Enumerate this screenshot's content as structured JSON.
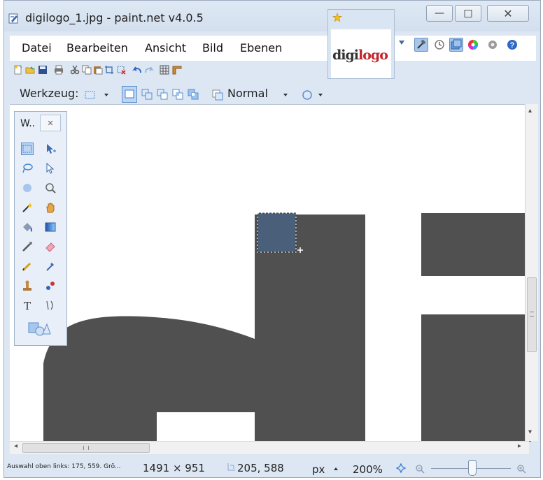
{
  "window": {
    "title": "digilogo_1.jpg - paint.net v4.0.5",
    "minimize_symbol": "—",
    "maximize_symbol": "□",
    "close_symbol": "✕"
  },
  "menu": {
    "items": [
      "Datei",
      "Bearbeiten",
      "Ansicht",
      "Bild",
      "Ebenen"
    ]
  },
  "image_thumbnail": {
    "logo_part1": "digi",
    "logo_part2": "logo"
  },
  "toolbar": {
    "tool_label": "Werkzeug:",
    "blend_mode": "Normal"
  },
  "tools_window": {
    "title": "W..",
    "close_symbol": "✕",
    "text_tool_glyph": "T"
  },
  "scrollbars": {
    "left_arrow": "◂",
    "right_arrow": "▸",
    "up_arrow": "▴",
    "down_arrow": "▾"
  },
  "status": {
    "selection_info": "Auswahl oben links: 175, 559. Grö...",
    "image_size": "1491 × 951",
    "cursor_position": "205, 588",
    "units": "px",
    "zoom": "200%"
  },
  "colors": {
    "accent": "#3d7fd6",
    "logo_dark": "#333333",
    "logo_red": "#c0262e",
    "shape_gray": "#505050",
    "selection_fill": "#4a5f7a"
  }
}
